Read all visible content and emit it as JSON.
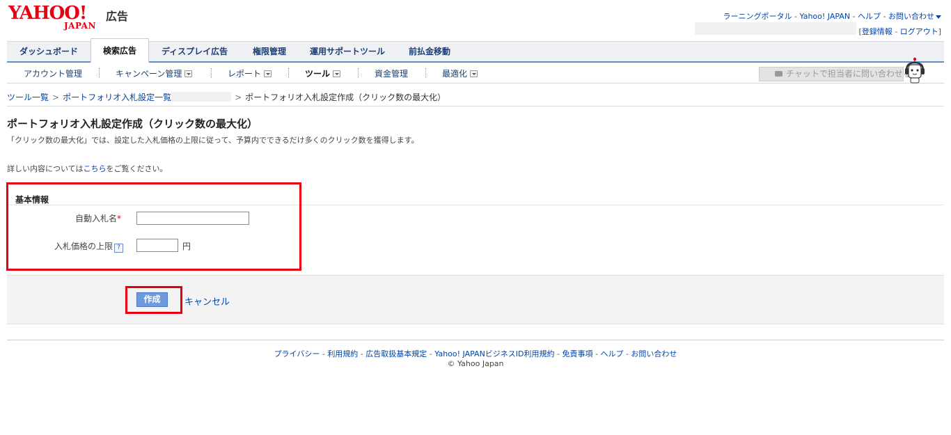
{
  "header": {
    "logo_yahoo": "YAHOO!",
    "logo_japan": "JAPAN",
    "logo_ad": "広告",
    "toplinks": [
      "ラーニングポータル",
      "Yahoo! JAPAN",
      "ヘルプ",
      "お問い合わせ"
    ],
    "account": {
      "open": "[",
      "register_info": "登録情報",
      "logout": "ログアウト",
      "close": "]"
    },
    "link_separator": " - "
  },
  "main_nav": {
    "tabs": [
      "ダッシュボード",
      "検索広告",
      "ディスプレイ広告",
      "権限管理",
      "運用サポートツール",
      "前払金移動"
    ],
    "active": "検索広告"
  },
  "sub_nav": {
    "items": [
      {
        "label": "アカウント管理",
        "dropdown": false
      },
      {
        "label": "キャンペーン管理",
        "dropdown": true
      },
      {
        "label": "レポート",
        "dropdown": true
      },
      {
        "label": "ツール",
        "dropdown": true,
        "active": true
      },
      {
        "label": "資金管理",
        "dropdown": false
      },
      {
        "label": "最適化",
        "dropdown": true
      }
    ],
    "chat_button": "チャットで担当者に問い合わせる"
  },
  "breadcrumb": {
    "items": [
      "ツール一覧",
      "ポートフォリオ入札設定一覧",
      "ポートフォリオ入札設定作成（クリック数の最大化）"
    ],
    "separator": ">"
  },
  "page": {
    "title": "ポートフォリオ入札設定作成（クリック数の最大化）",
    "description": "「クリック数の最大化」では、設定した入札価格の上限に従って、予算内でできるだけ多くのクリック数を獲得します。",
    "more_prefix": "詳しい内容については",
    "more_link": "こちら",
    "more_suffix": "をご覧ください。"
  },
  "form": {
    "section_title": "基本情報",
    "name_label": "自動入札名",
    "required_mark": "*",
    "name_value": "",
    "limit_label": "入札価格の上限",
    "help_mark": "?",
    "limit_value": "",
    "limit_unit": "円"
  },
  "actions": {
    "create": "作成",
    "cancel": "キャンセル"
  },
  "footer": {
    "links": [
      "プライバシー",
      "利用規約",
      "広告取扱基本規定",
      "Yahoo! JAPANビジネスID利用規約",
      "免責事項",
      "ヘルプ",
      "お問い合わせ"
    ],
    "copyright": "© Yahoo Japan"
  },
  "colors": {
    "brand_red": "#e60012",
    "link_blue": "#0044aa",
    "nav_text": "#1d3f73",
    "nav_underline": "#5f8fcd",
    "create_button": "#6f9bdc",
    "highlight_box": "#e60012"
  }
}
